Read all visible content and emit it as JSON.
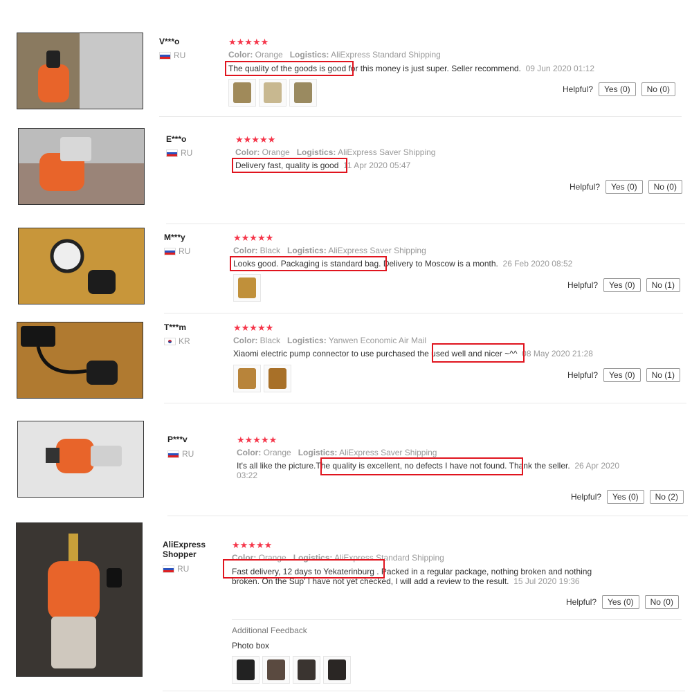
{
  "helpful_label": "Helpful?",
  "reviews": [
    {
      "user": "V***o",
      "country": "RU",
      "stars": "★★★★★",
      "color_label": "Color:",
      "color": "Orange",
      "logistics_label": "Logistics:",
      "logistics": "AliExpress Standard Shipping",
      "text_highlight": "The quality of the goods is good",
      "text_rest": " for this money is just super. Seller recommend.",
      "date": "09 Jun 2020 01:12",
      "yes": "Yes (0)",
      "no": "No (0)"
    },
    {
      "user": "E***o",
      "country": "RU",
      "stars": "★★★★★",
      "color_label": "Color:",
      "color": "Orange",
      "logistics_label": "Logistics:",
      "logistics": "AliExpress Saver Shipping",
      "text_highlight": "Delivery fast, quality is good",
      "text_rest": "",
      "date": "11 Apr 2020 05:47",
      "yes": "Yes (0)",
      "no": "No (0)"
    },
    {
      "user": "M***y",
      "country": "RU",
      "stars": "★★★★★",
      "color_label": "Color:",
      "color": "Black",
      "logistics_label": "Logistics:",
      "logistics": "AliExpress Saver Shipping",
      "text_highlight": "Looks good. Packaging is standard bag.",
      "text_rest": " Delivery to Moscow is a month.",
      "date": "26 Feb 2020 08:52",
      "yes": "Yes (0)",
      "no": "No (1)"
    },
    {
      "user": "T***m",
      "country": "KR",
      "stars": "★★★★★",
      "color_label": "Color:",
      "color": "Black",
      "logistics_label": "Logistics:",
      "logistics": "Yanwen Economic Air Mail",
      "text_pre": "Xiaomi electric pump connector to use purchased t",
      "text_highlight": "he used well and nicer ~",
      "text_rest": "^^",
      "date": "08 May 2020 21:28",
      "yes": "Yes (0)",
      "no": "No (1)"
    },
    {
      "user": "P***v",
      "country": "RU",
      "stars": "★★★★★",
      "color_label": "Color:",
      "color": "Orange",
      "logistics_label": "Logistics:",
      "logistics": "AliExpress Saver Shipping",
      "text_pre": "It's all like the picture.",
      "text_highlight": "The quality is excellent, no defects I have not found.",
      "text_rest": " Thank the seller.",
      "date": "26 Apr 2020 03:22",
      "yes": "Yes (0)",
      "no": "No (2)"
    },
    {
      "user": "AliExpress Shopper",
      "country": "RU",
      "stars": "★★★★★",
      "color_label": "Color:",
      "color": "Orange",
      "logistics_label": "Logistics:",
      "logistics": "AliExpress Standard Shipping",
      "text_highlight": "Fast delivery, 12 days to Yekaterinburg .",
      "text_rest": " Packed in a regular package, nothing broken and nothing broken. On the Sup' I have not yet checked, I will add a review to the result.",
      "date": "15 Jul 2020 19:36",
      "yes": "Yes (0)",
      "no": "No (0)",
      "additional_feedback": "Additional Feedback",
      "photo_box": "Photo box"
    }
  ]
}
